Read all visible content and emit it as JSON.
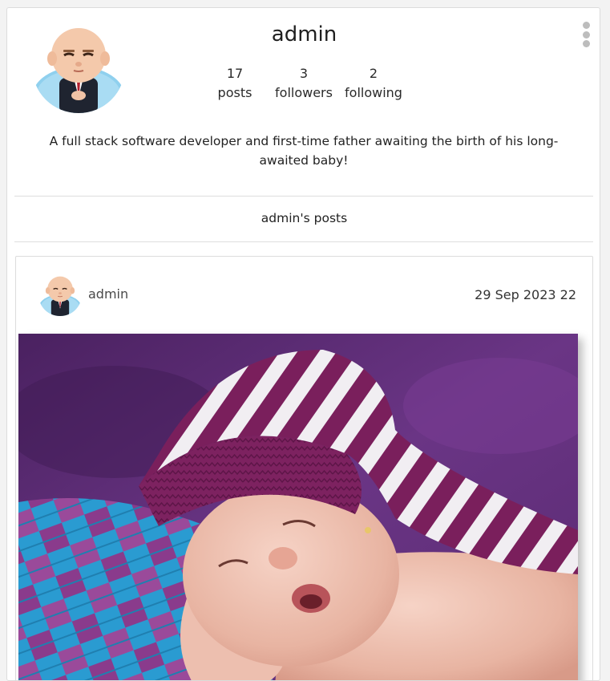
{
  "profile": {
    "username": "admin",
    "stats": {
      "posts_count": "17",
      "posts_label": "posts",
      "followers_count": "3",
      "followers_label": "followers",
      "following_count": "2",
      "following_label": "following"
    },
    "bio": "A full stack software developer and first-time father awaiting the birth of his long-awaited baby!",
    "menu_icon": "more-vertical-icon"
  },
  "posts_section": {
    "title": "admin's posts"
  },
  "post": {
    "author": "admin",
    "date": "29 Sep 2023 22",
    "image_subject": "sleeping baby in striped knit hat"
  },
  "colors": {
    "hat_purple": "#7a1f5c",
    "background_purple": "#5b2a6e",
    "blanket_blue": "#2a9bd1",
    "menu_dots": "#bdbdbd"
  }
}
